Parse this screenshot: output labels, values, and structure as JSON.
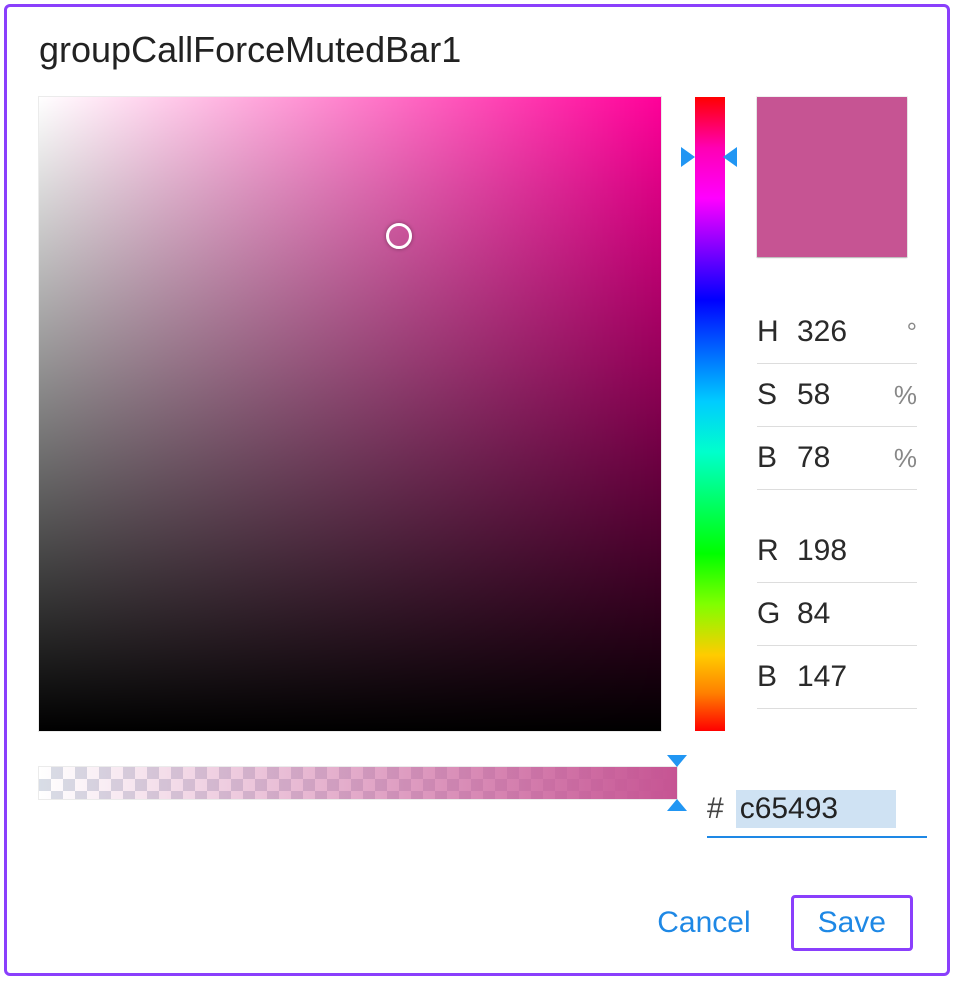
{
  "title": "groupCallForceMutedBar1",
  "picker": {
    "hue_base_hex": "#ff0099",
    "sb_cursor": {
      "x_pct": 58,
      "y_pct": 22
    },
    "hue_arrow_y_pct": 9.5,
    "alpha_arrow_x_pct": 100
  },
  "preview_hex": "#c65493",
  "hsb": {
    "labels": {
      "h": "H",
      "s": "S",
      "b": "B"
    },
    "h": "326",
    "s": "58",
    "b": "78",
    "units": {
      "h": "°",
      "s": "%",
      "b": "%"
    }
  },
  "rgb": {
    "labels": {
      "r": "R",
      "g": "G",
      "b": "B"
    },
    "r": "198",
    "g": "84",
    "b": "147"
  },
  "hex": {
    "prefix": "#",
    "value": "c65493"
  },
  "buttons": {
    "cancel": "Cancel",
    "save": "Save"
  }
}
